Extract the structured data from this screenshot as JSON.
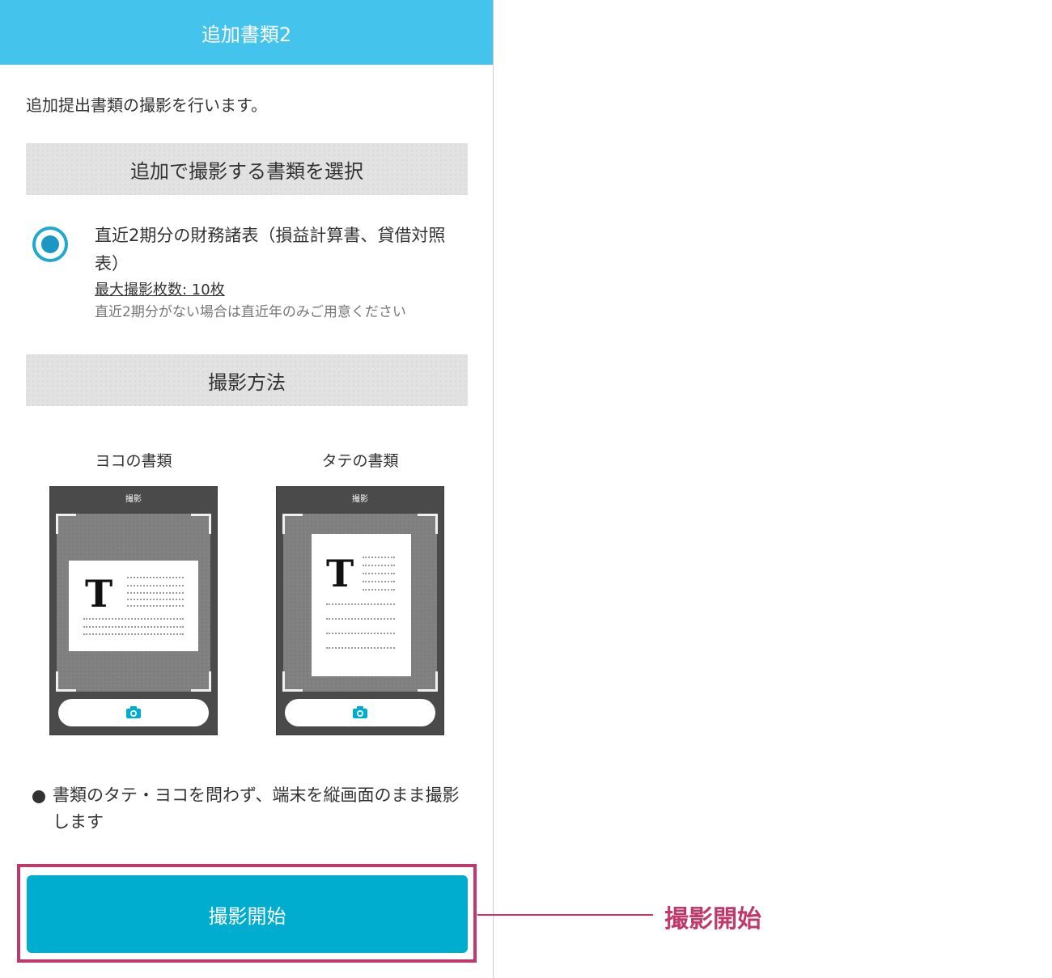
{
  "header": {
    "title": "追加書類2"
  },
  "intro_text": "追加提出書類の撮影を行います。",
  "select_section": {
    "heading": "追加で撮影する書類を選択",
    "option": {
      "selected": true,
      "title": "直近2期分の財務諸表（損益計算書、貸借対照表）",
      "limit": "最大撮影枚数: 10枚",
      "note": "直近2期分がない場合は直近年のみご用意ください"
    }
  },
  "method_section": {
    "heading": "撮影方法",
    "examples": [
      {
        "caption": "ヨコの書類",
        "screen_title": "撮影",
        "paper_glyph": "T",
        "orientation": "landscape",
        "shutter_icon": "camera-icon"
      },
      {
        "caption": "タテの書類",
        "screen_title": "撮影",
        "paper_glyph": "T",
        "orientation": "portrait",
        "shutter_icon": "camera-icon"
      }
    ],
    "note": "書類のタテ・ヨコを問わず、端末を縦画面のまま撮影します"
  },
  "start_button": {
    "label": "撮影開始"
  },
  "callout": {
    "label": "撮影開始"
  },
  "colors": {
    "header_bg": "#44c3ec",
    "button_bg": "#00adcf",
    "radio_accent": "#1fa9d0",
    "callout": "#c0396b",
    "section_bar_bg": "#e2e2e2"
  }
}
